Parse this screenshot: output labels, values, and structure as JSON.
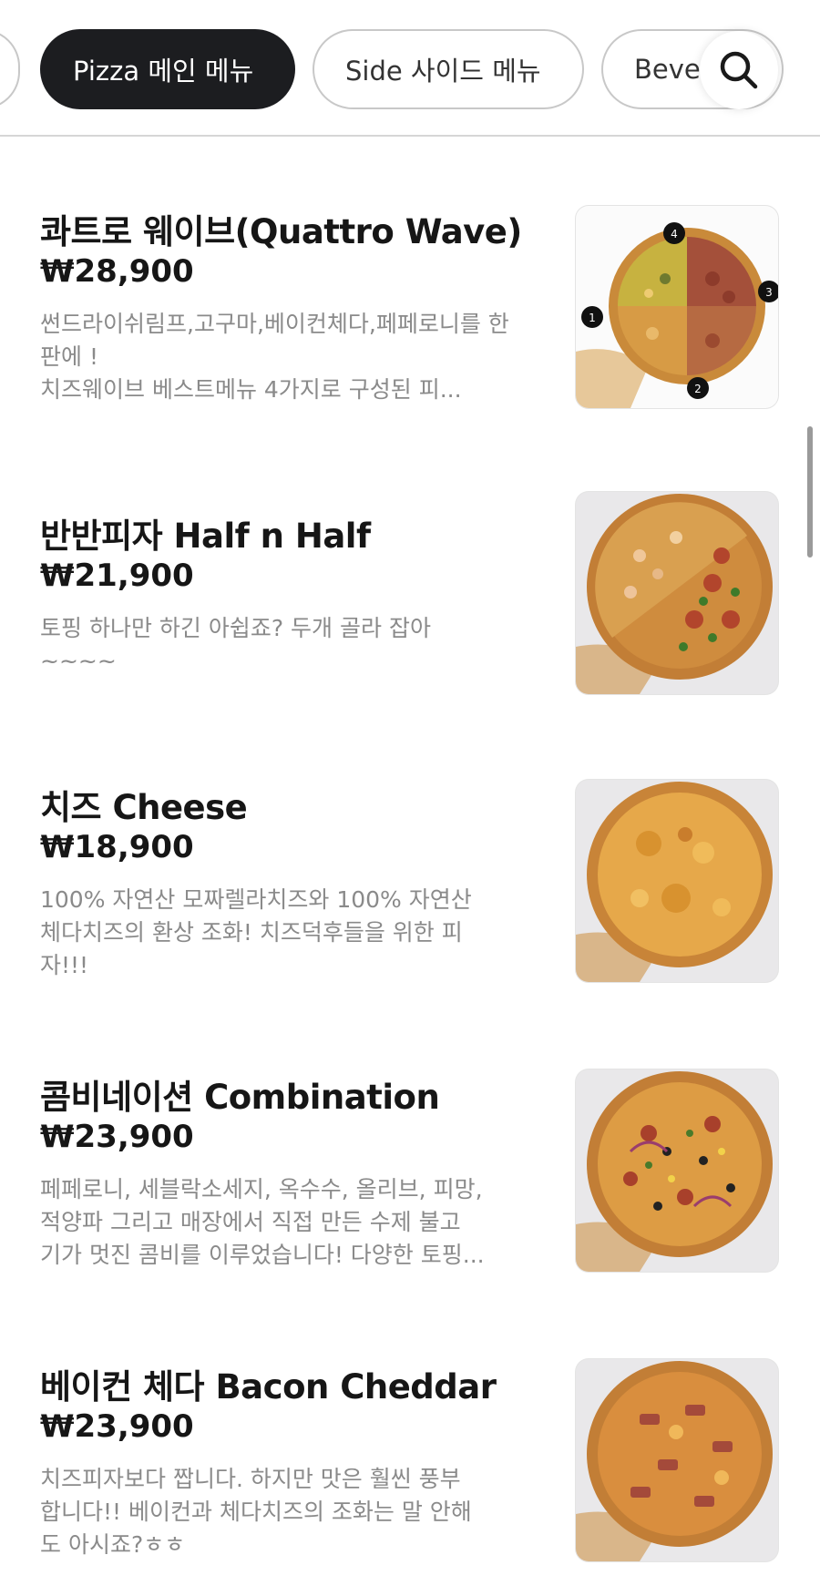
{
  "tabs": [
    {
      "label": "Pizza 메인 메뉴",
      "active": true
    },
    {
      "label": "Side 사이드 메뉴",
      "active": false
    },
    {
      "label": "Beve",
      "active": false
    }
  ],
  "search": {
    "icon": "search-icon"
  },
  "menu_items": [
    {
      "name": "콰트로 웨이브(Quattro Wave)",
      "price": "₩28,900",
      "description": "썬드라이쉬림프,고구마,베이컨체다,페페로니를 한 판에 !\n치즈웨이브 베스트메뉴 4가지로 구성된 피...",
      "image_icon": "quattro-pizza-image"
    },
    {
      "name": "반반피자 Half n Half",
      "price": "₩21,900",
      "description": "토핑 하나만 하긴 아쉽죠? 두개 골라 잡아~~~~",
      "image_icon": "half-half-pizza-image"
    },
    {
      "name": "치즈 Cheese",
      "price": "₩18,900",
      "description": "100% 자연산 모짜렐라치즈와 100% 자연산 체다치즈의 환상 조화! 치즈덕후들을 위한 피자!!!",
      "image_icon": "cheese-pizza-image"
    },
    {
      "name": "콤비네이션 Combination",
      "price": "₩23,900",
      "description": "페페로니, 세블락소세지, 옥수수, 올리브, 피망, 적양파 그리고 매장에서 직접 만든 수제 불고기가 멋진 콤비를 이루었습니다! 다양한 토핑...",
      "image_icon": "combination-pizza-image"
    },
    {
      "name": "베이컨 체다 Bacon Cheddar",
      "price": "₩23,900",
      "description": "치즈피자보다 짭니다. 하지만 맛은 훨씬 풍부합니다!! 베이컨과 체다치즈의 조화는 말 안해도 아시죠?ㅎㅎ",
      "image_icon": "bacon-cheddar-pizza-image"
    }
  ]
}
